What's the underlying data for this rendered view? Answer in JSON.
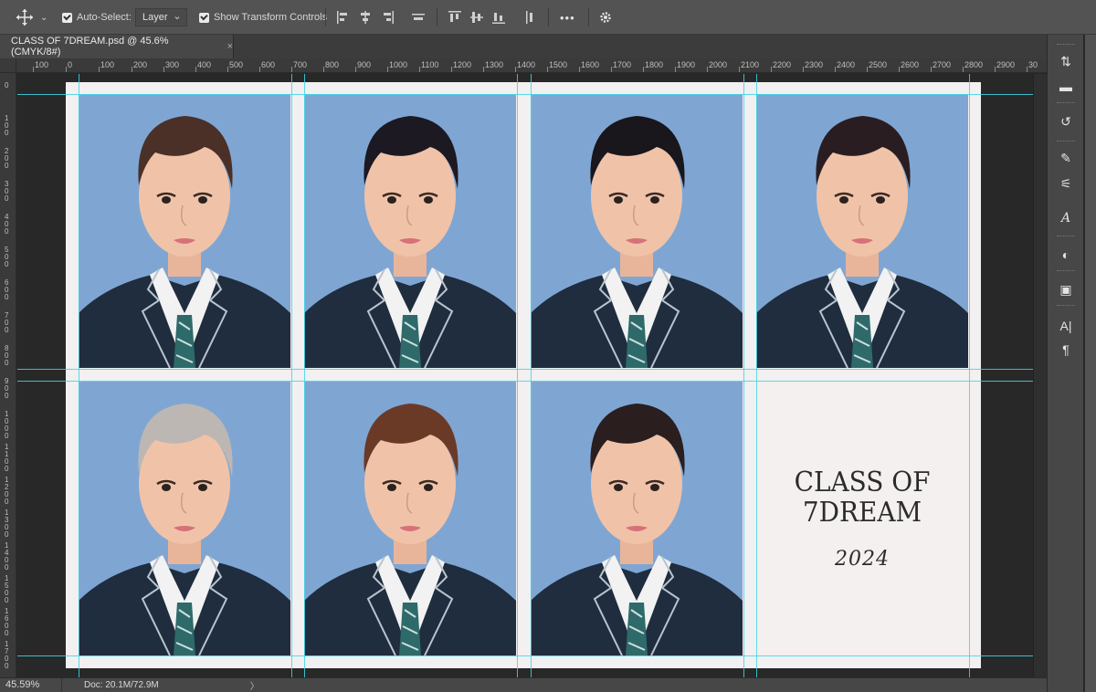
{
  "options_bar": {
    "tool_icon": "move-tool-icon",
    "auto_select_label": "Auto-Select:",
    "auto_select_checked": true,
    "auto_select_target": "Layer",
    "show_transform_label": "Show Transform Controls",
    "show_transform_checked": true,
    "more_label": "•••"
  },
  "document_tab": {
    "title": "CLASS OF 7DREAM.psd @ 45.6% (CMYK/8#)",
    "close": "×"
  },
  "ruler": {
    "h_labels": [
      "100",
      "0",
      "100",
      "200",
      "300",
      "400",
      "500",
      "600",
      "700",
      "800",
      "900",
      "1000",
      "1100",
      "1200",
      "1300",
      "1400",
      "1500",
      "1600",
      "1700",
      "1800",
      "1900",
      "2000",
      "2100",
      "2200",
      "2300",
      "2400",
      "2500",
      "2600",
      "2700",
      "2800",
      "2900",
      "30"
    ],
    "v_labels": [
      "0",
      "1\n0\n0",
      "2\n0\n0",
      "3\n0\n0",
      "4\n0\n0",
      "5\n0\n0",
      "6\n0\n0",
      "7\n0\n0",
      "8\n0\n0",
      "9\n0\n0",
      "1\n0\n0\n0",
      "1\n1\n0\n0",
      "1\n2\n0\n0",
      "1\n3\n0\n0",
      "1\n4\n0\n0",
      "1\n5\n0\n0",
      "1\n6\n0\n0",
      "1\n7\n0\n0"
    ]
  },
  "artwork": {
    "title_line1": "CLASS OF",
    "title_line2": "7DREAM",
    "year": "2024",
    "colors": {
      "background": "#7fa6d3",
      "paper": "#f2f0f0",
      "guide": "#3fd6e6",
      "suit": "#1f2d3f",
      "tie": "#2f6a6a"
    },
    "portraits": [
      {
        "hair": "#4a3026"
      },
      {
        "hair": "#1c1922"
      },
      {
        "hair": "#19161c"
      },
      {
        "hair": "#2a1d22"
      },
      {
        "hair": "#bdb7b3"
      },
      {
        "hair": "#6b3a26"
      },
      {
        "hair": "#2a1e1e"
      }
    ]
  },
  "status_bar": {
    "zoom": "45.59%",
    "doc": "Doc: 20.1M/72.9M",
    "arrow": "〉"
  },
  "right_panel": {
    "icons": [
      "properties-icon",
      "comment-icon",
      "history-icon",
      "brush-icon",
      "adjust-icon",
      "type-icon",
      "color-icon",
      "image-icon",
      "character-icon",
      "paragraph-icon"
    ]
  }
}
